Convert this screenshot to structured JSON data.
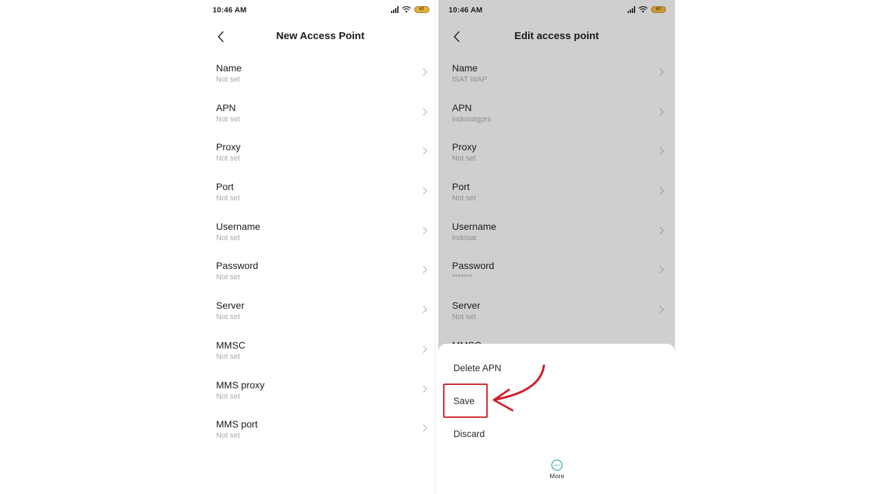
{
  "left_screen": {
    "status_bar": {
      "time": "10:46 AM",
      "battery_level": "67",
      "icons": [
        "signal-icon",
        "wifi-icon",
        "battery-icon"
      ]
    },
    "header": {
      "back_icon": "chevron-left-icon",
      "title": "New Access Point"
    },
    "fields": [
      {
        "label": "Name",
        "value": "Not set"
      },
      {
        "label": "APN",
        "value": "Not set"
      },
      {
        "label": "Proxy",
        "value": "Not set"
      },
      {
        "label": "Port",
        "value": "Not set"
      },
      {
        "label": "Username",
        "value": "Not set"
      },
      {
        "label": "Password",
        "value": "Not set"
      },
      {
        "label": "Server",
        "value": "Not set"
      },
      {
        "label": "MMSC",
        "value": "Not set"
      },
      {
        "label": "MMS proxy",
        "value": "Not set"
      },
      {
        "label": "MMS port",
        "value": "Not set"
      }
    ]
  },
  "right_screen": {
    "status_bar": {
      "time": "10:46 AM",
      "battery_level": "67",
      "icons": [
        "signal-icon",
        "wifi-icon",
        "battery-icon"
      ]
    },
    "header": {
      "back_icon": "chevron-left-icon",
      "title": "Edit access point"
    },
    "fields": [
      {
        "label": "Name",
        "value": "ISAT WAP"
      },
      {
        "label": "APN",
        "value": "indosatgprs"
      },
      {
        "label": "Proxy",
        "value": "Not set"
      },
      {
        "label": "Port",
        "value": "Not set"
      },
      {
        "label": "Username",
        "value": "indosat"
      },
      {
        "label": "Password",
        "value": "*******"
      },
      {
        "label": "Server",
        "value": "Not set"
      },
      {
        "label": "MMSC",
        "value": ""
      }
    ],
    "menu_sheet": {
      "items": [
        "Delete APN",
        "Save",
        "Discard"
      ],
      "highlighted_item": "Save",
      "more": {
        "label": "More",
        "icon": "more-horizontal-icon"
      }
    }
  },
  "annotation": {
    "highlight_color": "#d01f26",
    "arrow_icon": "curved-arrow-icon",
    "points_to": "Save"
  },
  "colors": {
    "dimmed_background": "#cfcfcf",
    "accent_more": "#3aa7a3"
  }
}
